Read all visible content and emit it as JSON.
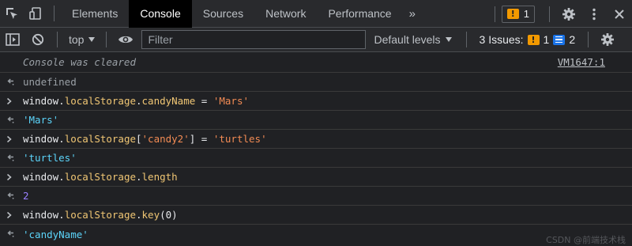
{
  "tabbar": {
    "tabs": [
      {
        "label": "Elements",
        "active": false
      },
      {
        "label": "Console",
        "active": true
      },
      {
        "label": "Sources",
        "active": false
      },
      {
        "label": "Network",
        "active": false
      },
      {
        "label": "Performance",
        "active": false
      }
    ],
    "more_tabs": "»",
    "issues_count": "1"
  },
  "toolbar": {
    "context": "top",
    "filter_placeholder": "Filter",
    "levels_label": "Default levels",
    "issues_label": "3 Issues:",
    "warning_count": "1",
    "info_count": "2"
  },
  "console": {
    "cleared_text": "Console was cleared",
    "cleared_source": "VM1647:1",
    "undefined_result": "undefined",
    "entries": [
      {
        "obj": "window.",
        "prop": "localStorage",
        "rest1": ".",
        "prop2": "candyName",
        "rest2": " = ",
        "str": "'Mars'",
        "result": "'Mars'",
        "result_type": "string"
      },
      {
        "obj": "window.",
        "prop": "localStorage",
        "rest1": "[",
        "str_key": "'candy2'",
        "rest2": "] = ",
        "str": "'turtles'",
        "result": "'turtles'",
        "result_type": "string"
      },
      {
        "obj": "window.",
        "prop": "localStorage",
        "rest1": ".",
        "prop2": "length",
        "result": "2",
        "result_type": "number"
      },
      {
        "obj": "window.",
        "prop": "localStorage",
        "rest1": ".",
        "prop2": "key",
        "rest2": "(",
        "num": "0",
        "rest3": ")",
        "result": "'candyName'",
        "result_type": "string"
      }
    ]
  },
  "watermark": "CSDN @前端技术栈"
}
